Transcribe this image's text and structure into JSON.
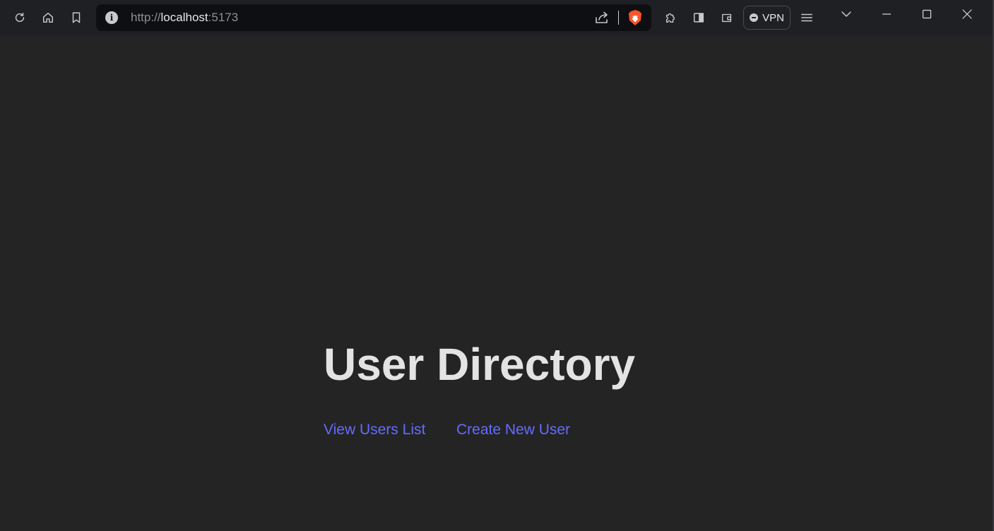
{
  "browser": {
    "url_scheme": "http://",
    "url_host": "localhost",
    "url_port": ":5173",
    "vpn_label": "VPN",
    "icons": [
      "reload-icon",
      "home-icon",
      "bookmark-icon",
      "site-info-icon",
      "share-icon",
      "brave-shields-icon",
      "extensions-icon",
      "sidebar-icon",
      "wallet-icon",
      "vpn-icon",
      "menu-icon",
      "tab-search-icon",
      "minimize-icon",
      "maximize-icon",
      "close-icon"
    ],
    "colors": {
      "toolbar": "#1f2024",
      "urlbar": "#0e0f12",
      "page_bg": "#242424"
    }
  },
  "page": {
    "title": "User Directory",
    "links": {
      "view_users": "View Users List",
      "create_user": "Create New User"
    },
    "colors": {
      "title": "#e3e3e3",
      "link": "#646cff"
    }
  }
}
